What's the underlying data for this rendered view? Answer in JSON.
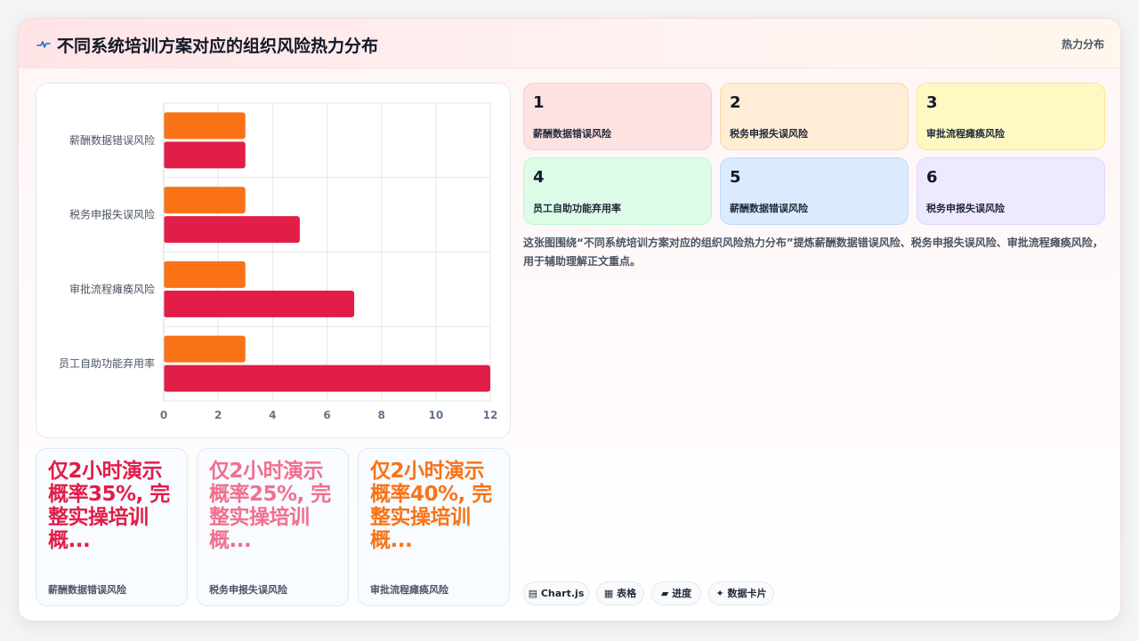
{
  "header": {
    "icon": "activity-line-icon",
    "title": "不同系统培训方案对应的组织风险热力分布",
    "badge": "热力分布"
  },
  "chart_data": {
    "type": "bar",
    "orientation": "horizontal",
    "categories": [
      "薪酬数据错误风险",
      "税务申报失误风险",
      "审批流程瘫痪风险",
      "员工自助功能弃用率"
    ],
    "series": [
      {
        "values": [
          3,
          3,
          3,
          3
        ],
        "color": "#f97316"
      },
      {
        "values": [
          3,
          5,
          7,
          12
        ],
        "color": "#e11d48"
      }
    ],
    "xlim": [
      0,
      12
    ],
    "xticks": [
      "0",
      "2",
      "4",
      "6",
      "8",
      "10",
      "12"
    ],
    "grid": true,
    "legend": "none"
  },
  "tiles": [
    {
      "num": "1",
      "label": "薪酬数据错误风险",
      "bg": "#fee2e2",
      "border": "#fecaca"
    },
    {
      "num": "2",
      "label": "税务申报失误风险",
      "bg": "#ffedd5",
      "border": "#fed7aa"
    },
    {
      "num": "3",
      "label": "审批流程瘫痪风险",
      "bg": "#fef9c3",
      "border": "#fde68a"
    },
    {
      "num": "4",
      "label": "员工自助功能弃用率",
      "bg": "#dcfce7",
      "border": "#bbf7d0"
    },
    {
      "num": "5",
      "label": "薪酬数据错误风险",
      "bg": "#dbeafe",
      "border": "#bfdbfe"
    },
    {
      "num": "6",
      "label": "税务申报失误风险",
      "bg": "#ede9fe",
      "border": "#ddd6fe"
    }
  ],
  "description": "这张图围绕“不同系统培训方案对应的组织风险热力分布”提炼薪酬数据错误风险、税务申报失误风险、审批流程瘫痪风险，用于辅助理解正文重点。",
  "stats": [
    {
      "value": "仅2小时演示 概率35%, 完整实操培训概...",
      "label": "薪酬数据错误风险",
      "color": "#e11d48"
    },
    {
      "value": "仅2小时演示 概率25%, 完整实操培训概...",
      "label": "税务申报失误风险",
      "color": "#f0708e"
    },
    {
      "value": "仅2小时演示 概率40%, 完整实操培训概...",
      "label": "审批流程瘫痪风险",
      "color": "#f97316"
    }
  ],
  "chips": [
    {
      "icon": "chart-icon",
      "glyph": "▤",
      "label": "Chart.js"
    },
    {
      "icon": "table-icon",
      "glyph": "▦",
      "label": "表格"
    },
    {
      "icon": "progress-icon",
      "glyph": "▰",
      "label": "进度"
    },
    {
      "icon": "sparkle-icon",
      "glyph": "✦",
      "label": "数据卡片"
    }
  ]
}
